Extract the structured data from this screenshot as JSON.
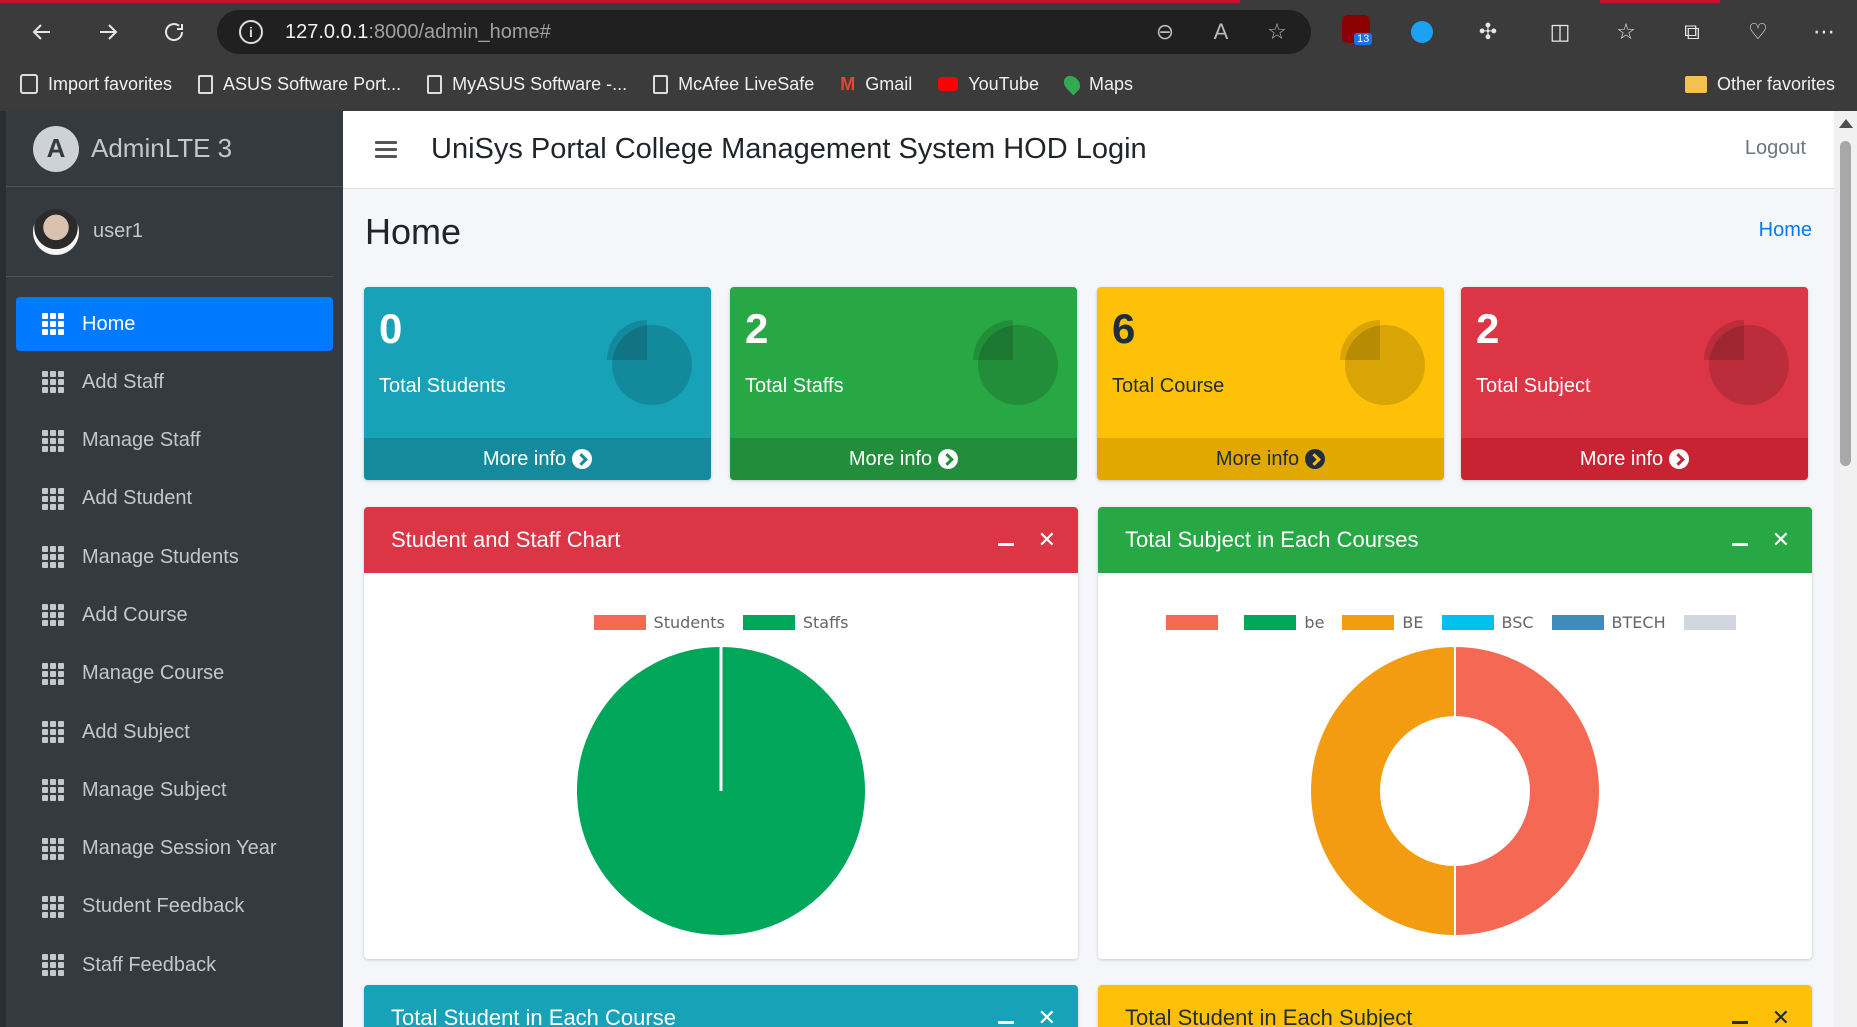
{
  "browser": {
    "url_host": "127.0.0.1",
    "url_rest": ":8000/admin_home#",
    "extension_badge": "13",
    "bookmarks": [
      {
        "label": "Import favorites",
        "icon": "import-icon"
      },
      {
        "label": "ASUS Software Port...",
        "icon": "page-icon"
      },
      {
        "label": "MyASUS Software -...",
        "icon": "page-icon"
      },
      {
        "label": "McAfee LiveSafe",
        "icon": "page-icon"
      },
      {
        "label": "Gmail",
        "icon": "gmail-icon"
      },
      {
        "label": "YouTube",
        "icon": "youtube-icon"
      },
      {
        "label": "Maps",
        "icon": "maps-icon"
      }
    ],
    "other_favorites": "Other favorites"
  },
  "sidebar": {
    "brand": "AdminLTE 3",
    "brand_logo_letter": "A",
    "user": "user1",
    "items": [
      {
        "label": "Home",
        "active": true
      },
      {
        "label": "Add Staff"
      },
      {
        "label": "Manage Staff"
      },
      {
        "label": "Add Student"
      },
      {
        "label": "Manage Students"
      },
      {
        "label": "Add Course"
      },
      {
        "label": "Manage Course"
      },
      {
        "label": "Add Subject"
      },
      {
        "label": "Manage Subject"
      },
      {
        "label": "Manage Session Year"
      },
      {
        "label": "Student Feedback"
      },
      {
        "label": "Staff Feedback"
      }
    ]
  },
  "header": {
    "title": "UniSys Portal College Management System HOD Login",
    "logout": "Logout"
  },
  "page": {
    "title": "Home",
    "breadcrumb": "Home"
  },
  "stats": [
    {
      "value": "0",
      "label": "Total Students",
      "more": "More info",
      "color": "#17a2b8"
    },
    {
      "value": "2",
      "label": "Total Staffs",
      "more": "More info",
      "color": "#28a745"
    },
    {
      "value": "6",
      "label": "Total Course",
      "more": "More info",
      "color": "#ffc107"
    },
    {
      "value": "2",
      "label": "Total Subject",
      "more": "More info",
      "color": "#dc3545"
    }
  ],
  "cards": {
    "student_staff": {
      "title": "Student and Staff Chart"
    },
    "subject_courses": {
      "title": "Total Subject in Each Courses"
    },
    "student_course": {
      "title": "Total Student in Each Course"
    },
    "student_subject": {
      "title": "Total Student in Each Subject"
    }
  },
  "chart_data": [
    {
      "type": "pie",
      "title": "Student and Staff Chart",
      "categories": [
        "Students",
        "Staffs"
      ],
      "values": [
        0,
        2
      ],
      "colors": [
        "#f56954",
        "#00a65a"
      ]
    },
    {
      "type": "pie",
      "title": "Total Subject in Each Courses",
      "donut": true,
      "categories": [
        "",
        "be",
        "BE",
        "BSC",
        "BTECH",
        ""
      ],
      "values": [
        1,
        0,
        1,
        0,
        0,
        0
      ],
      "colors": [
        "#f56954",
        "#00a65a",
        "#f39c12",
        "#00c0ef",
        "#3c8dbc",
        "#d2d6de"
      ]
    }
  ]
}
